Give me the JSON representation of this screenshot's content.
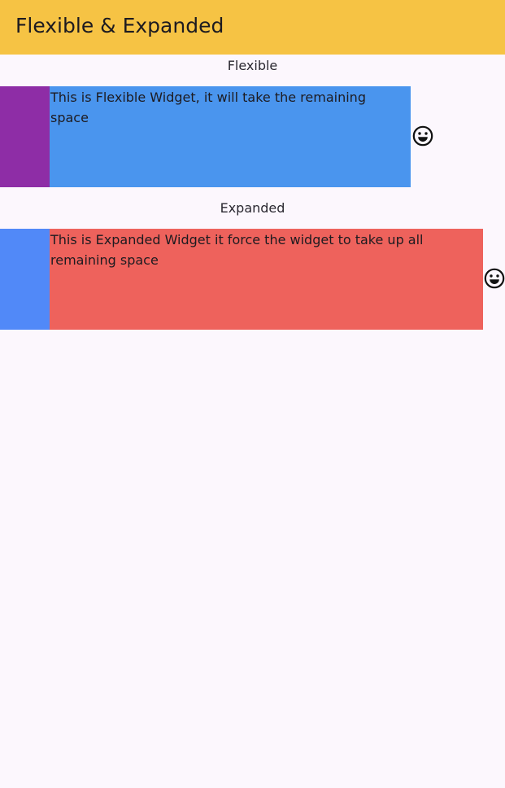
{
  "appbar": {
    "title": "Flexible & Expanded",
    "color": "#f6c344"
  },
  "flexible_section": {
    "label": "Flexible",
    "side_box_color": "#8e2da6",
    "main_box_color": "#4a95ee",
    "text": "This is Flexible Widget, it will take the remaining space",
    "icon": "smiley-emoji-icon"
  },
  "expanded_section": {
    "label": "Expanded",
    "side_box_color": "#5189f8",
    "main_box_color": "#ee625c",
    "text": "This is Expanded Widget it force the widget to take up all remaining space",
    "icon": "smiley-emoji-icon"
  }
}
